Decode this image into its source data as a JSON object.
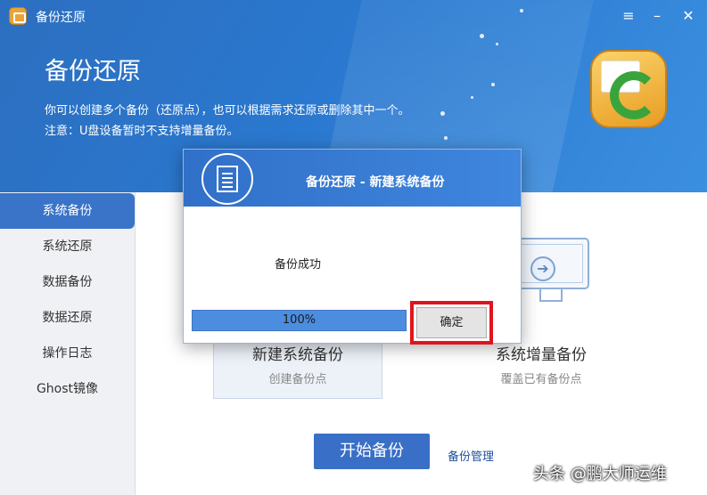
{
  "window": {
    "title": "备份还原",
    "menu_icon": "menu-icon",
    "minimize_icon": "minimize-icon",
    "close_icon": "close-icon"
  },
  "header": {
    "title": "备份还原",
    "description_line1": "你可以创建多个备份（还原点），也可以根据需求还原或删除其中一个。",
    "description_line2": "注意：U盘设备暂时不支持增量备份。"
  },
  "sidebar": {
    "items": [
      {
        "label": "系统备份",
        "active": true
      },
      {
        "label": "系统还原",
        "active": false
      },
      {
        "label": "数据备份",
        "active": false
      },
      {
        "label": "数据还原",
        "active": false
      },
      {
        "label": "操作日志",
        "active": false
      },
      {
        "label": "Ghost镜像",
        "active": false
      }
    ]
  },
  "main": {
    "cards": [
      {
        "title": "新建系统备份",
        "subtitle": "创建备份点"
      },
      {
        "title": "系统增量备份",
        "subtitle": "覆盖已有备份点"
      }
    ],
    "start_button": "开始备份",
    "manage_link": "备份管理"
  },
  "dialog": {
    "title": "备份还原 - 新建系统备份",
    "message": "备份成功",
    "progress_percent": 100,
    "progress_label": "100%",
    "ok_button": "确定"
  },
  "watermark": "头条 @鹏大师运维",
  "colors": {
    "header_blue": "#2a78cf",
    "sidebar_active": "#3a74c9",
    "start_button": "#3a6fc7",
    "highlight_red": "#e0141e"
  }
}
